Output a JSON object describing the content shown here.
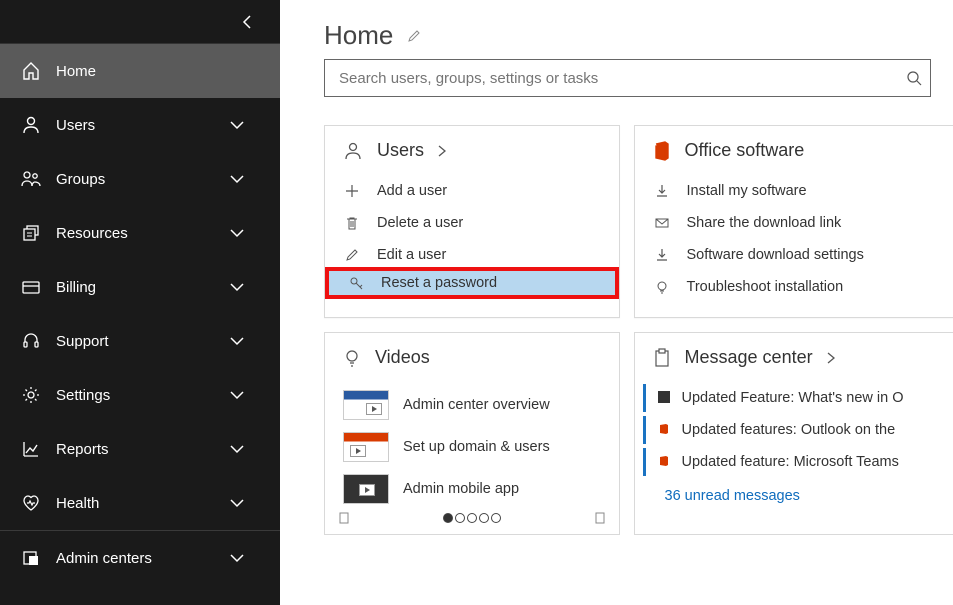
{
  "page": {
    "title": "Home",
    "search_placeholder": "Search users, groups, settings or tasks"
  },
  "sidebar": {
    "items": [
      {
        "label": "Home"
      },
      {
        "label": "Users"
      },
      {
        "label": "Groups"
      },
      {
        "label": "Resources"
      },
      {
        "label": "Billing"
      },
      {
        "label": "Support"
      },
      {
        "label": "Settings"
      },
      {
        "label": "Reports"
      },
      {
        "label": "Health"
      },
      {
        "label": "Admin centers"
      }
    ]
  },
  "cards": {
    "users": {
      "title": "Users",
      "actions": [
        {
          "label": "Add a user"
        },
        {
          "label": "Delete a user"
        },
        {
          "label": "Edit a user"
        },
        {
          "label": "Reset a password"
        }
      ]
    },
    "office": {
      "title": "Office software",
      "actions": [
        {
          "label": "Install my software"
        },
        {
          "label": "Share the download link"
        },
        {
          "label": "Software download settings"
        },
        {
          "label": "Troubleshoot installation"
        }
      ]
    },
    "videos": {
      "title": "Videos",
      "items": [
        {
          "label": "Admin center overview"
        },
        {
          "label": "Set up domain & users"
        },
        {
          "label": "Admin mobile app"
        }
      ]
    },
    "messages": {
      "title": "Message center",
      "items": [
        {
          "label": "Updated Feature: What's new in O"
        },
        {
          "label": "Updated features: Outlook on the"
        },
        {
          "label": "Updated feature: Microsoft Teams"
        }
      ],
      "link": "36 unread messages"
    }
  }
}
